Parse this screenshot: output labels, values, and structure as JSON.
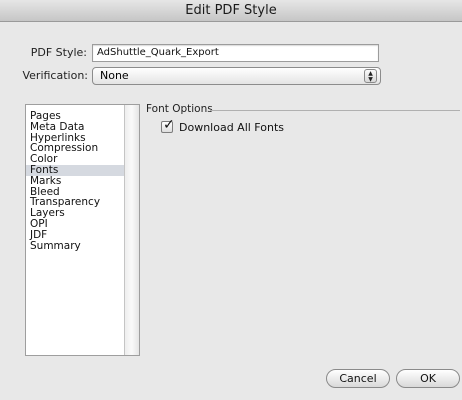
{
  "window": {
    "title": "Edit PDF Style"
  },
  "form": {
    "pdf_style_label": "PDF Style:",
    "pdf_style_value": "AdShuttle_Quark_Export",
    "verification_label": "Verification:",
    "verification_value": "None"
  },
  "sidebar": {
    "items": [
      {
        "label": "Pages",
        "selected": false
      },
      {
        "label": "Meta Data",
        "selected": false
      },
      {
        "label": "Hyperlinks",
        "selected": false
      },
      {
        "label": "Compression",
        "selected": false
      },
      {
        "label": "Color",
        "selected": false
      },
      {
        "label": "Fonts",
        "selected": true
      },
      {
        "label": "Marks",
        "selected": false
      },
      {
        "label": "Bleed",
        "selected": false
      },
      {
        "label": "Transparency",
        "selected": false
      },
      {
        "label": "Layers",
        "selected": false
      },
      {
        "label": "OPI",
        "selected": false
      },
      {
        "label": "JDF",
        "selected": false
      },
      {
        "label": "Summary",
        "selected": false
      }
    ]
  },
  "panel": {
    "group_title": "Font Options",
    "download_all_fonts_label": "Download All Fonts",
    "download_all_fonts_checked": true
  },
  "buttons": {
    "cancel": "Cancel",
    "ok": "OK"
  }
}
